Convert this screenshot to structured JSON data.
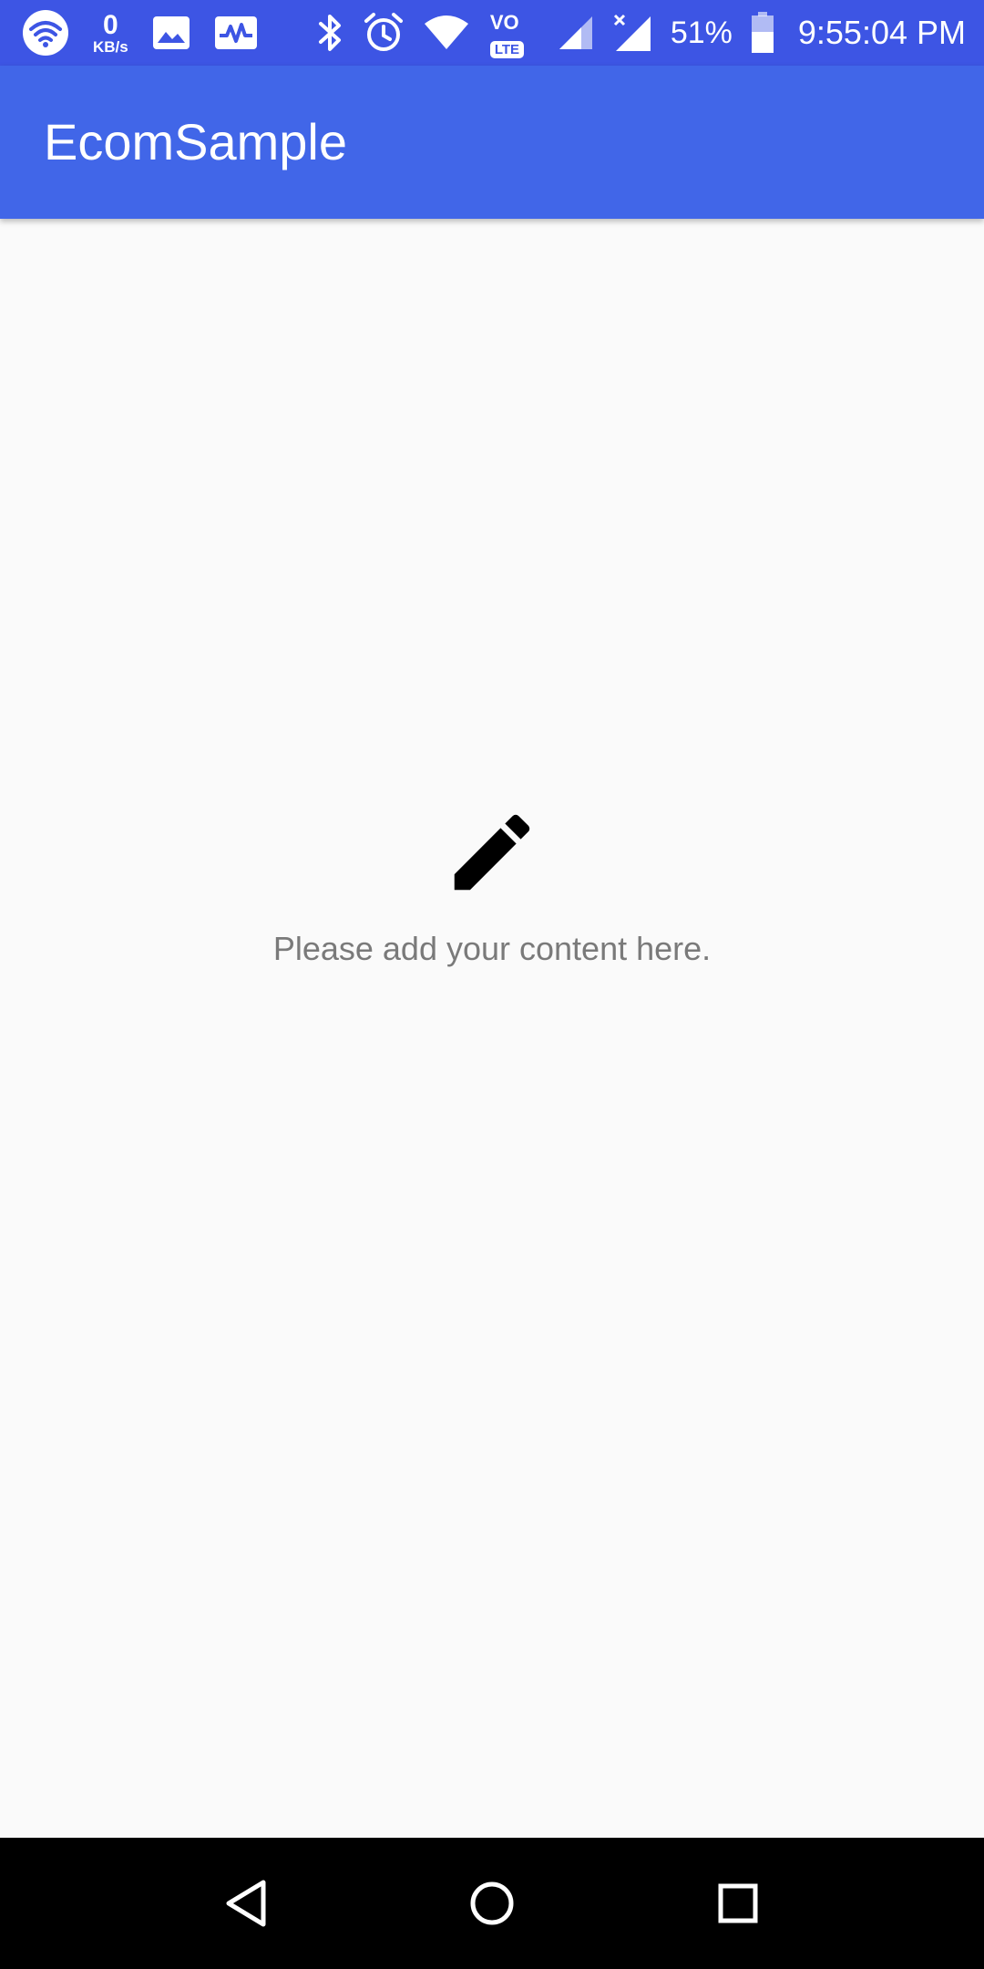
{
  "status_bar": {
    "net_speed_value": "0",
    "net_speed_unit": "KB/s",
    "volte_top": "VO",
    "volte_bottom": "LTE",
    "battery_percent": "51%",
    "time": "9:55:04 PM",
    "icons": [
      "wifi-icon",
      "gallery-icon",
      "activity-icon",
      "bluetooth-icon",
      "alarm-icon",
      "wifi-signal-icon",
      "volte-icon",
      "signal-icon",
      "signal-no-data-icon",
      "battery-icon"
    ],
    "background_color": "#3d55e4"
  },
  "app_bar": {
    "title": "EcomSample",
    "background_color": "#4166e8"
  },
  "content": {
    "icon": "pencil-icon",
    "message": "Please add your content here."
  },
  "nav_bar": {
    "icons": [
      "back-icon",
      "home-icon",
      "recents-icon"
    ]
  }
}
